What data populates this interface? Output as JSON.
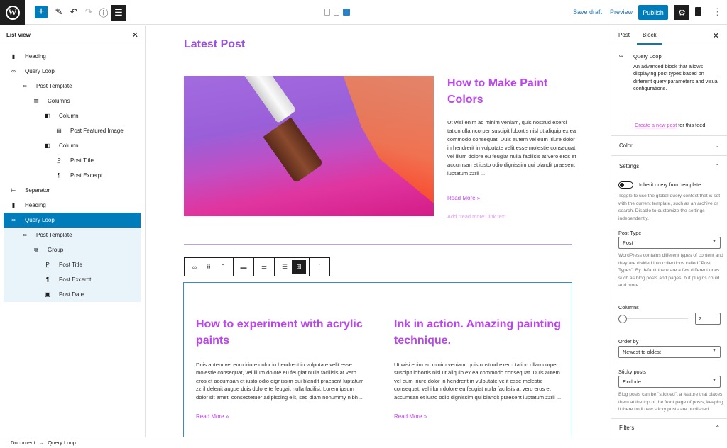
{
  "topbar": {
    "logo": "W",
    "add_icon": "+",
    "tools_icon": "✎",
    "undo_icon": "↶",
    "redo_icon": "↷",
    "info_icon": "ⓘ",
    "listview_icon": "☰",
    "save_draft": "Save draft",
    "preview": "Preview",
    "publish": "Publish",
    "settings_icon": "⚙",
    "more_icon": "⋮"
  },
  "listview": {
    "title": "List view",
    "close_icon": "✕",
    "items": [
      {
        "icon": "▮",
        "label": "Heading"
      },
      {
        "icon": "∞",
        "label": "Query Loop"
      },
      {
        "icon": "∞",
        "label": "Post Template"
      },
      {
        "icon": "▥",
        "label": "Columns"
      },
      {
        "icon": "◧",
        "label": "Column"
      },
      {
        "icon": "▤",
        "label": "Post Featured Image"
      },
      {
        "icon": "◧",
        "label": "Column"
      },
      {
        "icon": "P̲",
        "label": "Post Title"
      },
      {
        "icon": "¶",
        "label": "Post Excerpt"
      },
      {
        "icon": "⊢",
        "label": "Separator"
      },
      {
        "icon": "▮",
        "label": "Heading"
      },
      {
        "icon": "∞",
        "label": "Query Loop"
      },
      {
        "icon": "∞",
        "label": "Post Template"
      },
      {
        "icon": "⧉",
        "label": "Group"
      },
      {
        "icon": "P̲",
        "label": "Post Title"
      },
      {
        "icon": "¶",
        "label": "Post Excerpt"
      },
      {
        "icon": "▣",
        "label": "Post Date"
      }
    ]
  },
  "canvas": {
    "heading": "Latest Post",
    "post1": {
      "title": "How to Make Paint Colors",
      "excerpt": "Ut wisi enim ad minim veniam, quis nostrud exerci tation ullamcorper suscipit lobortis nisl ut aliquip ex ea commodo consequat. Duis autem vel eum iriure dolor in hendrerit in vulputate velit esse molestie consequat, vel illum dolore eu feugiat nulla facilisis at vero eros et accumsan et iusto odio dignissim qui blandit praesent luptatum zzril ...",
      "read_more": "Read More »",
      "read_more_hint": "Add \"read more\" link text"
    },
    "toolbar": {
      "icons": [
        "∞",
        "⠿",
        "⌃",
        "▬",
        "⚌",
        "☰",
        "⊞",
        "⋮"
      ]
    },
    "query_posts": [
      {
        "title": "How to experiment with acrylic paints",
        "excerpt": "Duis autem vel eum iriure dolor in hendrerit in vulputate velit esse molestie consequat, vel illum dolore eu feugiat nulla facilisis at vero eros et accumsan et iusto odio dignissim qui blandit praesent luptatum zzril delenit augue duis dolore te feugait nulla facilisi. Lorem ipsum dolor sit amet, consectetuer adipiscing elit, sed diam nonummy nibh ...",
        "read_more": "Read More »"
      },
      {
        "title": "Ink in action. Amazing painting technique.",
        "excerpt": "Ut wisi enim ad minim veniam, quis nostrud exerci tation ullamcorper suscipit lobortis nisl ut aliquip ex ea commodo consequat. Duis autem vel eum iriure dolor in hendrerit in vulputate velit esse molestie consequat, vel illum dolore eu feugiat nulla facilisis at vero eros et accumsan et iusto odio dignissim qui blandit praesent luptatum zzril ...",
        "read_more": "Read More »"
      }
    ]
  },
  "sidebar": {
    "tabs": [
      "Post",
      "Block"
    ],
    "active_tab": "Block",
    "close_icon": "✕",
    "block": {
      "icon": "∞",
      "title": "Query Loop",
      "description": "An advanced block that allows displaying post types based on different query parameters and visual configurations.",
      "create_link": "Create a new post",
      "create_suffix": " for this feed."
    },
    "color_panel": {
      "label": "Color",
      "icon": "⌄"
    },
    "settings_panel": {
      "label": "Settings",
      "icon": "⌃",
      "inherit_label": "Inherit query from template",
      "inherit_enabled": false,
      "inherit_help": "Toggle to use the global query context that is set with the current template, such as an archive or search. Disable to customize the settings independently.",
      "post_type_label": "Post Type",
      "post_type_value": "Post",
      "post_type_help": "WordPress contains different types of content and they are divided into collections called \"Post Types\". By default there are a few different ones such as blog posts and pages, but plugins could add more.",
      "columns_label": "Columns",
      "columns_value": "2",
      "order_label": "Order by",
      "order_value": "Newest to oldest",
      "sticky_label": "Sticky posts",
      "sticky_value": "Exclude",
      "sticky_help": "Blog posts can be \"stickied\", a feature that places them at the top of the front page of posts, keeping it there until new sticky posts are published."
    },
    "filters_panel": {
      "label": "Filters",
      "icon": "⌃"
    }
  },
  "footer": {
    "breadcrumb": [
      "Document",
      "Query Loop"
    ],
    "separator": "→"
  }
}
